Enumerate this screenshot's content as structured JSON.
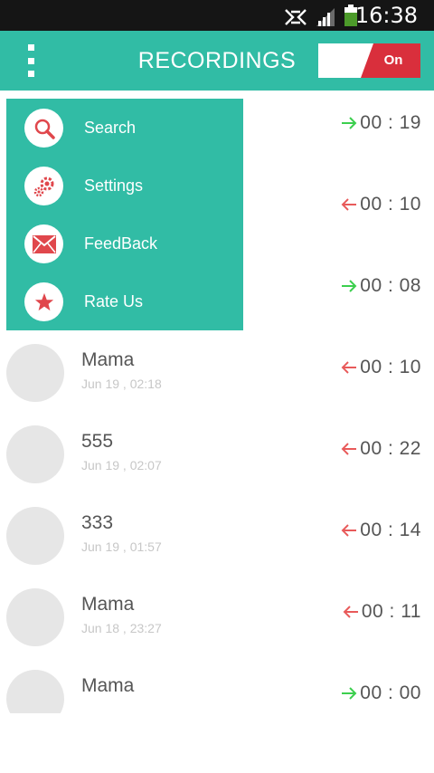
{
  "status_bar": {
    "time": "16:38"
  },
  "header": {
    "title": "RECORDINGS",
    "toggle_label": "On"
  },
  "menu": {
    "items": [
      {
        "label": "Search",
        "icon": "search-icon"
      },
      {
        "label": "Settings",
        "icon": "gear-icon"
      },
      {
        "label": "FeedBack",
        "icon": "mail-icon"
      },
      {
        "label": "Rate Us",
        "icon": "star-icon"
      }
    ]
  },
  "recordings": [
    {
      "name": "",
      "date": "",
      "duration": "00 : 19",
      "direction": "outgoing"
    },
    {
      "name": "",
      "date": "",
      "duration": "00 : 10",
      "direction": "incoming"
    },
    {
      "name": "",
      "date": "",
      "duration": "00 : 08",
      "direction": "outgoing"
    },
    {
      "name": "Mama",
      "date": "Jun 19 , 02:18",
      "duration": "00 : 10",
      "direction": "incoming"
    },
    {
      "name": "555",
      "date": "Jun 19 , 02:07",
      "duration": "00 : 22",
      "direction": "incoming"
    },
    {
      "name": "333",
      "date": "Jun 19 , 01:57",
      "duration": "00 : 14",
      "direction": "incoming"
    },
    {
      "name": "Mama",
      "date": "Jun 18 , 23:27",
      "duration": "00 : 11",
      "direction": "incoming"
    },
    {
      "name": "Mama",
      "date": "",
      "duration": "00 : 00",
      "direction": "outgoing"
    }
  ],
  "colors": {
    "accent": "#31bca5",
    "toggle_on": "#d92f3c",
    "outgoing_arrow": "#3ccf4e",
    "incoming_arrow": "#e85a5a",
    "icon_red": "#e0474c"
  }
}
